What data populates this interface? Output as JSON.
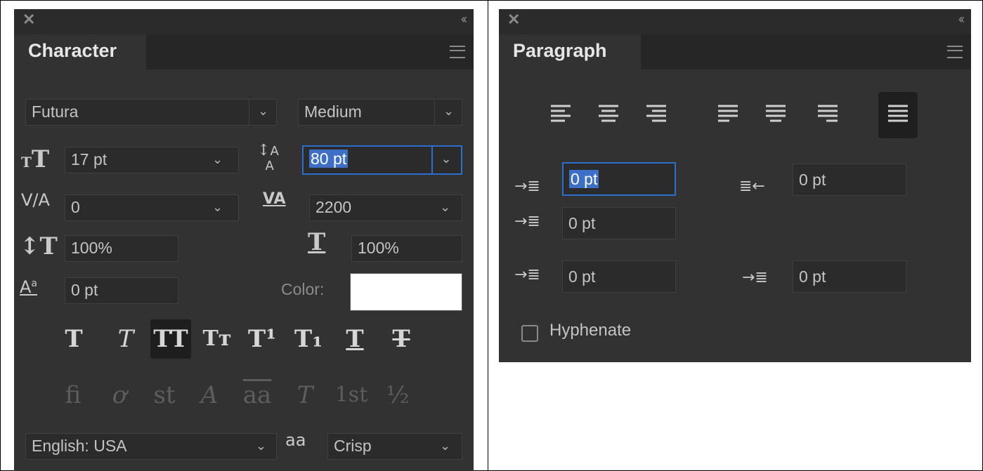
{
  "character": {
    "tab_title": "Character",
    "font_family": "Futura",
    "font_style": "Medium",
    "font_size": "17 pt",
    "leading": "80 pt",
    "kerning": "0",
    "tracking": "2200",
    "vertical_scale": "100%",
    "horizontal_scale": "100%",
    "baseline_shift": "0 pt",
    "color_label": "Color:",
    "color_value": "#ffffff",
    "type_buttons": [
      "T",
      "T",
      "TT",
      "Tт",
      "T¹",
      "T₁",
      "T",
      "T"
    ],
    "opentype_buttons": [
      "fi",
      "ơ",
      "st",
      "A",
      "aa",
      "T",
      "1st",
      "½"
    ],
    "language": "English: USA",
    "antialias_icon": "aa",
    "antialias": "Crisp"
  },
  "paragraph": {
    "tab_title": "Paragraph",
    "indent_left": "0 pt",
    "indent_right": "0 pt",
    "indent_first_line": "0 pt",
    "space_before": "0 pt",
    "space_after": "0 pt",
    "hyphenate_label": "Hyphenate",
    "hyphenate_checked": false,
    "selected_alignment": "justify-all"
  }
}
